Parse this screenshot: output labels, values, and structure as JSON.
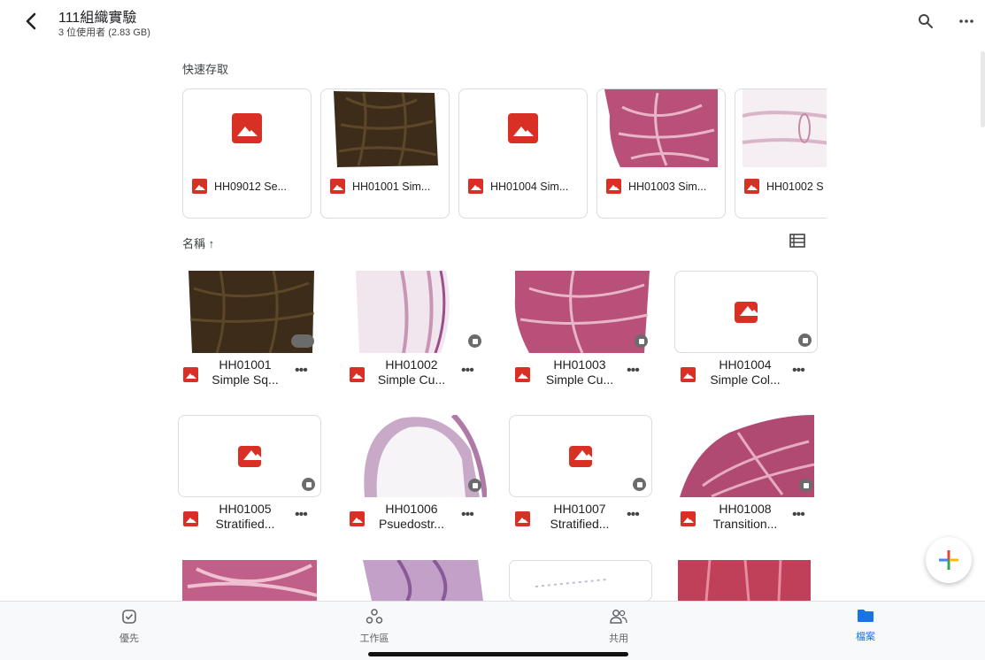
{
  "header": {
    "title": "111組織實驗",
    "subtitle": "3 位使用者 (2.83 GB)"
  },
  "quick_access": {
    "label": "快速存取",
    "items": [
      {
        "name": "HH09012 Se...",
        "thumb": "placeholder"
      },
      {
        "name": "HH01001 Sim...",
        "thumb": "dark"
      },
      {
        "name": "HH01004 Sim...",
        "thumb": "placeholder"
      },
      {
        "name": "HH01003 Sim...",
        "thumb": "pink"
      },
      {
        "name": "HH01002 S",
        "thumb": "pale"
      }
    ]
  },
  "sort": {
    "label": "名稱 ↑"
  },
  "files": [
    {
      "line1": "HH01001",
      "line2": "Simple Sq...",
      "thumb": "dark"
    },
    {
      "line1": "HH01002",
      "line2": "Simple Cu...",
      "thumb": "pale"
    },
    {
      "line1": "HH01003",
      "line2": "Simple Cu...",
      "thumb": "pink"
    },
    {
      "line1": "HH01004",
      "line2": "Simple Col...",
      "thumb": "placeholder"
    },
    {
      "line1": "HH01005",
      "line2": "Stratified...",
      "thumb": "placeholder"
    },
    {
      "line1": "HH01006",
      "line2": "Psuedostr...",
      "thumb": "ring"
    },
    {
      "line1": "HH01007",
      "line2": "Stratified...",
      "thumb": "placeholder"
    },
    {
      "line1": "HH01008",
      "line2": "Transition...",
      "thumb": "wavy"
    }
  ],
  "bottom_nav": [
    {
      "label": "優先",
      "icon": "check-circle-icon",
      "active": false
    },
    {
      "label": "工作區",
      "icon": "workspace-icon",
      "active": false
    },
    {
      "label": "共用",
      "icon": "shared-people-icon",
      "active": false
    },
    {
      "label": "檔案",
      "icon": "folder-icon",
      "active": true
    }
  ],
  "colors": {
    "accent": "#1a73e8",
    "image_icon": "#d93025"
  }
}
